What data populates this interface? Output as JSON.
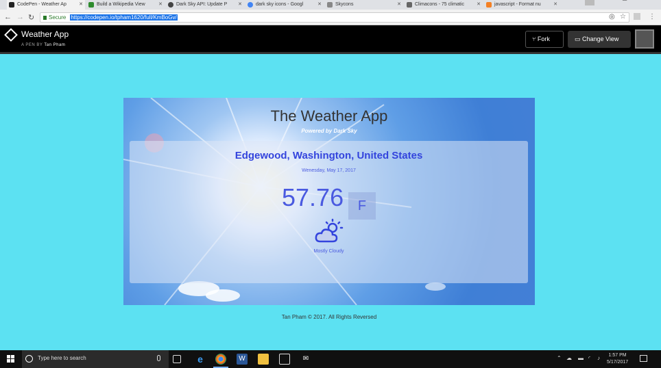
{
  "browser": {
    "tabs": [
      {
        "label": "CodePen - Weather Ap",
        "icon_color": "#222222"
      },
      {
        "label": "Build a Wikipedia View",
        "icon_color": "#2e8b2e"
      },
      {
        "label": "Dark Sky API: Update P",
        "icon_color": "#444444"
      },
      {
        "label": "dark sky icons - Googl",
        "icon_color": "#4285f4"
      },
      {
        "label": "Skycons",
        "icon_color": "#888888"
      },
      {
        "label": "Climacons - 75 climatic",
        "icon_color": "#666666"
      },
      {
        "label": "javascript - Format nu",
        "icon_color": "#f48024"
      }
    ],
    "back_icon": "back-arrow-icon",
    "forward_icon": "forward-arrow-icon",
    "reload_icon": "reload-icon",
    "secure_label": "Secure",
    "url": "https://codepen.io/tpham1620/full/KmBoGv/"
  },
  "codepen": {
    "title": "Weather App",
    "byline_prefix": "A PEN BY",
    "author": "Tan Pham",
    "fork_label": "Fork",
    "change_view_label": "Change View"
  },
  "weather": {
    "app_title": "The Weather App",
    "powered_by": "Powered by Dark Sky",
    "location": "Edgewood, Washington, United States",
    "date": "Wenesday, May 17, 2017",
    "temperature": "57.76",
    "unit": "F",
    "icon": "partly-cloudy-day-icon",
    "summary": "Mostly Cloudy"
  },
  "footer": {
    "text": "Tan Pham © 2017. All Rights Reversed"
  },
  "taskbar": {
    "search_placeholder": "Type here to search",
    "time": "1:57 PM",
    "date": "5/17/2017"
  },
  "colors": {
    "page_background": "#5ce1f2",
    "accent_blue": "#3344dd",
    "text_blue": "#4a5ae0"
  }
}
